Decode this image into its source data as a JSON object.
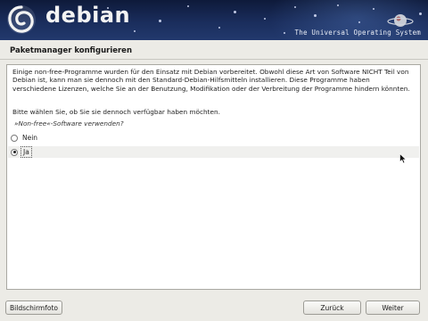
{
  "banner": {
    "logo_text": "debian",
    "tagline": "The Universal Operating System"
  },
  "page": {
    "title": "Paketmanager konfigurieren"
  },
  "content": {
    "description": "Einige non-free-Programme wurden für den Einsatz mit Debian vorbereitet. Obwohl diese Art von Software NICHT Teil von Debian ist, kann man sie dennoch mit den Standard-Debian-Hilfsmitteln installieren. Diese Programme haben verschiedene Lizenzen, welche Sie an der Benutzung, Modifikation oder der Verbreitung der Programme hindern könnten.",
    "prompt": "Bitte wählen Sie, ob Sie sie dennoch verfügbar haben möchten.",
    "question": "»Non-free«-Software verwenden?",
    "options": [
      {
        "label": "Nein",
        "checked": false
      },
      {
        "label": "Ja",
        "checked": true
      }
    ]
  },
  "buttons": {
    "screenshot": "Bildschirmfoto",
    "back": "Zurück",
    "next": "Weiter"
  },
  "colors": {
    "banner_bg": "#1a2d5c",
    "page_bg": "#ecebe6",
    "panel_bg": "#ffffff"
  },
  "icons": {
    "logo": "debian-swirl-icon",
    "planet": "planet-icon",
    "cursor": "mouse-cursor-icon"
  }
}
